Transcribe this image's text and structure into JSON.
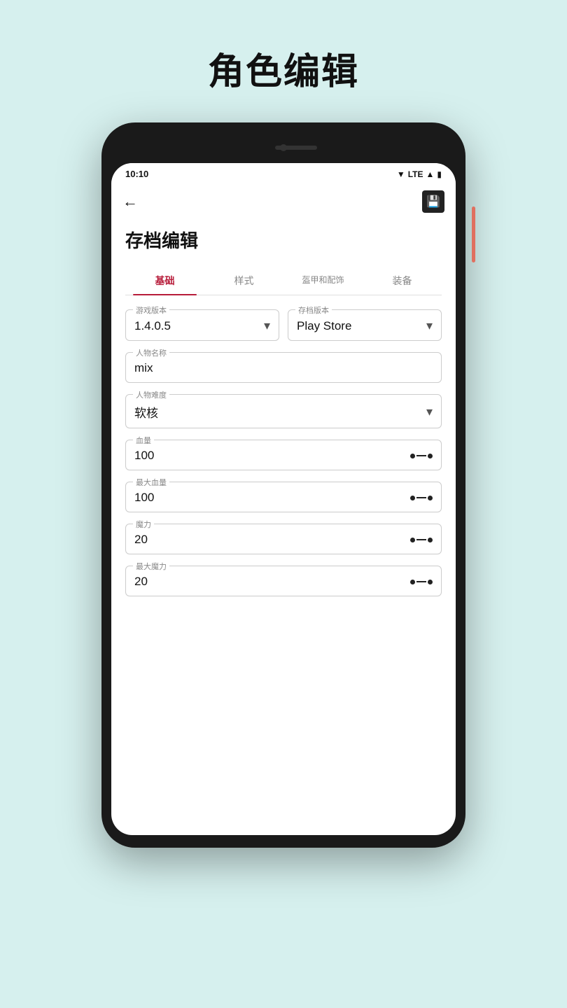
{
  "page": {
    "title": "角色编辑"
  },
  "statusBar": {
    "time": "10:10",
    "signal": "▼ LTE",
    "battery": "🔋"
  },
  "appBar": {
    "backLabel": "←",
    "saveLabel": "💾"
  },
  "screen": {
    "sectionTitle": "存档编辑",
    "tabs": [
      {
        "label": "基础",
        "active": true
      },
      {
        "label": "样式",
        "active": false
      },
      {
        "label": "盔甲和配饰",
        "active": false
      },
      {
        "label": "装备",
        "active": false
      }
    ],
    "fields": {
      "gameVersion": {
        "label": "游戏版本",
        "value": "1.4.0.5"
      },
      "saveVersion": {
        "label": "存档版本",
        "value": "Play Store"
      },
      "characterName": {
        "label": "人物名称",
        "value": "mix"
      },
      "characterDifficulty": {
        "label": "人物难度",
        "value": "软核"
      },
      "health": {
        "label": "血量",
        "value": "100"
      },
      "maxHealth": {
        "label": "最大血量",
        "value": "100"
      },
      "mana": {
        "label": "魔力",
        "value": "20"
      },
      "maxMana": {
        "label": "最大魔力",
        "value": "20"
      }
    }
  }
}
